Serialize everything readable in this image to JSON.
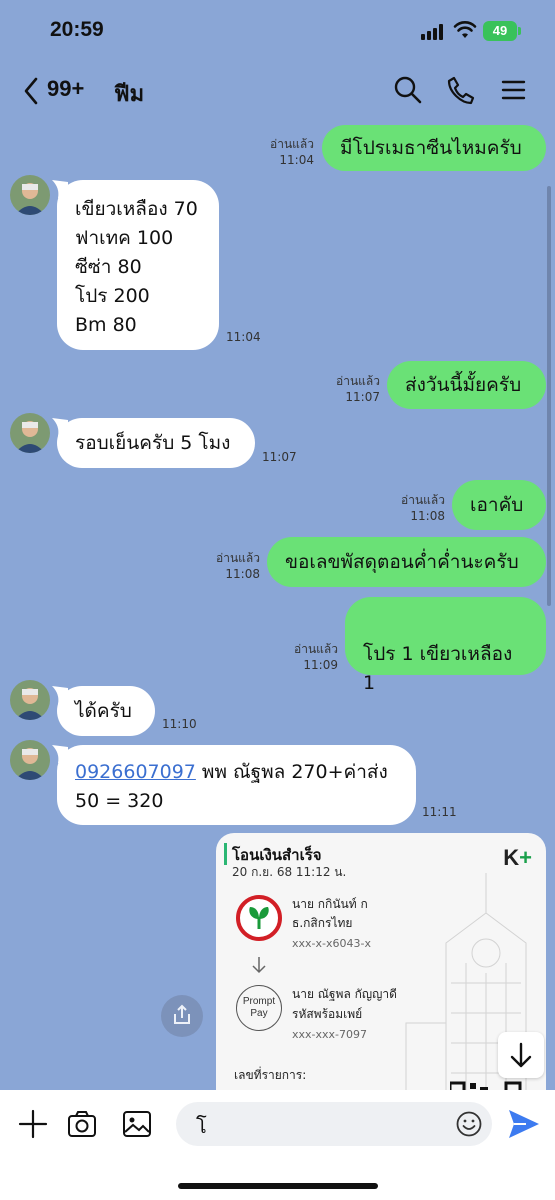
{
  "status": {
    "time": "20:59",
    "battery": "49"
  },
  "header": {
    "unread": "99+",
    "name": "ฟีม"
  },
  "messages": [
    {
      "dir": "out",
      "text": "มีโปรเมธาซีนไหมครับ",
      "read": "อ่านแล้ว",
      "time": "11:04"
    },
    {
      "dir": "in",
      "lines": [
        "เขียวเหลือง 70",
        "ฟาเทค 100",
        "ซีซ่า 80",
        "โปร 200",
        "Bm 80"
      ],
      "time": "11:04"
    },
    {
      "dir": "out",
      "text": "ส่งวันนี้มั้ยครับ",
      "read": "อ่านแล้ว",
      "time": "11:07"
    },
    {
      "dir": "in",
      "text": "รอบเย็นครับ 5 โมง",
      "time": "11:07"
    },
    {
      "dir": "out",
      "text": "เอาคับ",
      "read": "อ่านแล้ว",
      "time": "11:08"
    },
    {
      "dir": "out",
      "text": "ขอเลขพัสดุตอนค่ำค่ำนะครับ",
      "read": "อ่านแล้ว",
      "time": "11:08"
    },
    {
      "dir": "out",
      "text": "โปร 1 เขียวเหลือง 1",
      "read": "อ่านแล้ว",
      "time": "11:09"
    },
    {
      "dir": "in",
      "text": "ได้ครับ",
      "time": "11:10"
    },
    {
      "dir": "in",
      "phone": "0926607097",
      "text_after": " พพ ณัฐพล 270+ค่าส่ง",
      "line2": "50 = 320",
      "time": "11:11"
    }
  ],
  "receipt": {
    "title": "โอนเงินสำเร็จ",
    "date": "20 ก.ย. 68  11:12 น.",
    "brand_k": "K",
    "brand_plus": "+",
    "from_name": "นาย กกินันท์ ก",
    "from_bank": "ธ.กสิกรไทย",
    "from_acct": "xxx-x-x6043-x",
    "promptpay_label_1": "Prompt",
    "promptpay_label_2": "Pay",
    "to_name": "นาย ณัฐพล กัญญาดี",
    "to_bank": "รหัสพร้อมเพย์",
    "to_acct": "xxx-xxx-7097",
    "ref_label": "เลขที่รายการ:"
  },
  "composer": {
    "text": "โ"
  }
}
